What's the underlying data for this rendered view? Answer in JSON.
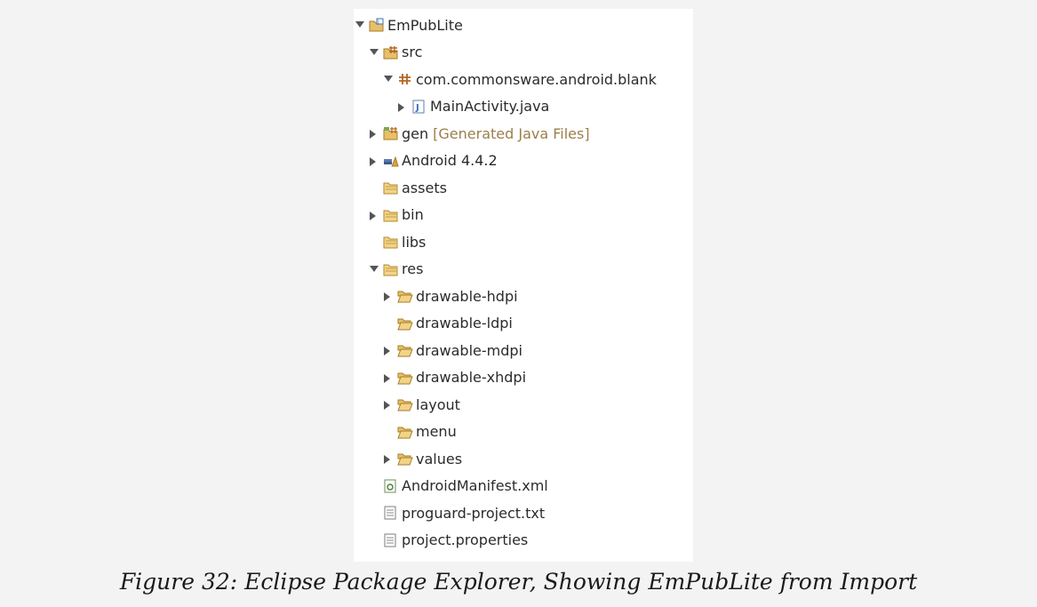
{
  "tree": {
    "items": [
      {
        "label": "EmPubLite",
        "decoration": "",
        "level": 0,
        "toggle": "expanded",
        "icon": "java-project-icon"
      },
      {
        "label": "src",
        "decoration": "",
        "level": 1,
        "toggle": "expanded",
        "icon": "source-folder-icon"
      },
      {
        "label": "com.commonsware.android.blank",
        "decoration": "",
        "level": 2,
        "toggle": "expanded",
        "icon": "package-icon"
      },
      {
        "label": "MainActivity.java",
        "decoration": "",
        "level": 3,
        "toggle": "collapsed",
        "icon": "java-file-icon"
      },
      {
        "label": "gen",
        "decoration": "[Generated Java Files]",
        "level": 1,
        "toggle": "collapsed",
        "icon": "gen-folder-icon"
      },
      {
        "label": "Android 4.4.2",
        "decoration": "",
        "level": 1,
        "toggle": "collapsed",
        "icon": "library-icon"
      },
      {
        "label": "assets",
        "decoration": "",
        "level": 1,
        "toggle": "none",
        "icon": "folder-icon"
      },
      {
        "label": "bin",
        "decoration": "",
        "level": 1,
        "toggle": "collapsed",
        "icon": "folder-icon"
      },
      {
        "label": "libs",
        "decoration": "",
        "level": 1,
        "toggle": "none",
        "icon": "folder-icon"
      },
      {
        "label": "res",
        "decoration": "",
        "level": 1,
        "toggle": "expanded",
        "icon": "folder-icon"
      },
      {
        "label": "drawable-hdpi",
        "decoration": "",
        "level": 2,
        "toggle": "collapsed",
        "icon": "open-folder-icon"
      },
      {
        "label": "drawable-ldpi",
        "decoration": "",
        "level": 2,
        "toggle": "none",
        "icon": "open-folder-icon"
      },
      {
        "label": "drawable-mdpi",
        "decoration": "",
        "level": 2,
        "toggle": "collapsed",
        "icon": "open-folder-icon"
      },
      {
        "label": "drawable-xhdpi",
        "decoration": "",
        "level": 2,
        "toggle": "collapsed",
        "icon": "open-folder-icon"
      },
      {
        "label": "layout",
        "decoration": "",
        "level": 2,
        "toggle": "collapsed",
        "icon": "open-folder-icon"
      },
      {
        "label": "menu",
        "decoration": "",
        "level": 2,
        "toggle": "none",
        "icon": "open-folder-icon"
      },
      {
        "label": "values",
        "decoration": "",
        "level": 2,
        "toggle": "collapsed",
        "icon": "open-folder-icon"
      },
      {
        "label": "AndroidManifest.xml",
        "decoration": "",
        "level": 1,
        "toggle": "none",
        "icon": "xml-file-icon"
      },
      {
        "label": "proguard-project.txt",
        "decoration": "",
        "level": 1,
        "toggle": "none",
        "icon": "text-file-icon"
      },
      {
        "label": "project.properties",
        "decoration": "",
        "level": 1,
        "toggle": "none",
        "icon": "text-file-icon"
      }
    ]
  },
  "caption": "Figure 32: Eclipse Package Explorer, Showing EmPubLite from Import",
  "colors": {
    "folder": "#d9a441",
    "decoration": "#9b7f4a",
    "package": "#b5651d",
    "java": "#3b6fb6"
  }
}
